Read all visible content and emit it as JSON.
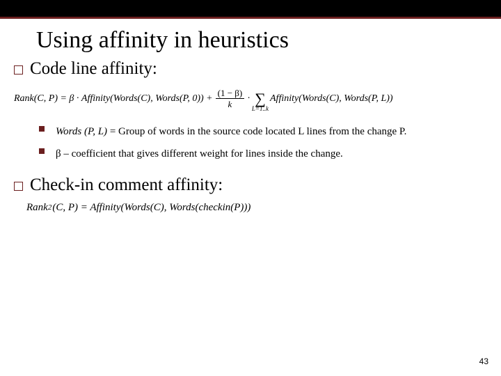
{
  "title": "Using affinity in heuristics",
  "section1": {
    "heading": "Code line affinity:",
    "formula": {
      "lhs": "Rank(C, P) = β · Affinity(Words(C), Words(P, 0)) +",
      "frac_num": "(1 − β)",
      "frac_den": "k",
      "dot": "·",
      "sum_lower": "L=1..k",
      "rhs": "Affinity(Words(C), Words(P, L))"
    },
    "bullets": [
      {
        "italic_lead": "Words (P, L)",
        "rest": " = Group of words in the source code located L lines from the change P."
      },
      {
        "italic_lead": "",
        "rest": "β – coefficient that gives different weight for lines inside the change."
      }
    ]
  },
  "section2": {
    "heading": "Check-in comment affinity:",
    "formula_sub": "2",
    "formula": "(C, P) = Affinity(Words(C), Words(checkin(P)))",
    "formula_pre": "Rank"
  },
  "page_number": "43"
}
